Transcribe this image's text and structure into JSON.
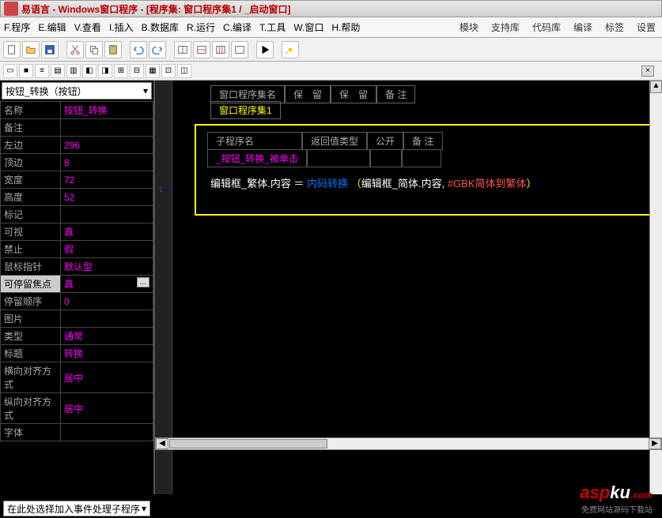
{
  "title": "易语言 - Windows窗口程序 - [程序集: 窗口程序集1 / _启动窗口]",
  "menu": [
    "F.程序",
    "E.编辑",
    "V.查看",
    "I.插入",
    "B.数据库",
    "R.运行",
    "C.编译",
    "T.工具",
    "W.窗口",
    "H.帮助"
  ],
  "rmenu": [
    "模块",
    "支持库",
    "代码库",
    "编译",
    "标签",
    "设置"
  ],
  "combo": "按钮_转换（按钮）",
  "props": [
    {
      "k": "名称",
      "v": "按钮_转换",
      "sel": false
    },
    {
      "k": "备注",
      "v": "",
      "sel": false
    },
    {
      "k": "左边",
      "v": "296",
      "sel": false
    },
    {
      "k": "顶边",
      "v": "8",
      "sel": false
    },
    {
      "k": "宽度",
      "v": "72",
      "sel": false
    },
    {
      "k": "高度",
      "v": "52",
      "sel": false
    },
    {
      "k": "标记",
      "v": "",
      "sel": false
    },
    {
      "k": "可视",
      "v": "真",
      "sel": false
    },
    {
      "k": "禁止",
      "v": "假",
      "sel": false
    },
    {
      "k": "鼠标指针",
      "v": "默认型",
      "sel": false
    },
    {
      "k": "可停留焦点",
      "v": "真",
      "sel": true
    },
    {
      "k": "  停留顺序",
      "v": "0",
      "sel": false
    },
    {
      "k": "图片",
      "v": "",
      "sel": false
    },
    {
      "k": "类型",
      "v": "通常",
      "sel": false
    },
    {
      "k": "标题",
      "v": "转换",
      "sel": false
    },
    {
      "k": "横向对齐方式",
      "v": "居中",
      "sel": false
    },
    {
      "k": "纵向对齐方式",
      "v": "居中",
      "sel": false
    },
    {
      "k": "字体",
      "v": "",
      "sel": false
    }
  ],
  "tabs": {
    "t1": "窗口程序集名",
    "t2": "保　留",
    "t3": "保　留",
    "t4": "备 注",
    "active": "窗口程序集1"
  },
  "sub": {
    "h1": "子程序名",
    "h2": "返回值类型",
    "h3": "公开",
    "h4": "备 注",
    "name": "_按钮_转换_被单击"
  },
  "code": {
    "lhs": "编辑框_繁体.内容",
    "eq": " ＝ ",
    "fn": "内码转换",
    "lp": "（",
    "arg": "编辑框_简体.内容, ",
    "cm": "#GBK简体到繁体",
    "rp": "）"
  },
  "status": "在此处选择加入事件处理子程序",
  "wm": {
    "a": "asp",
    "b": "ku",
    "c": ".com",
    "sub": "免费网站源码下载站"
  }
}
